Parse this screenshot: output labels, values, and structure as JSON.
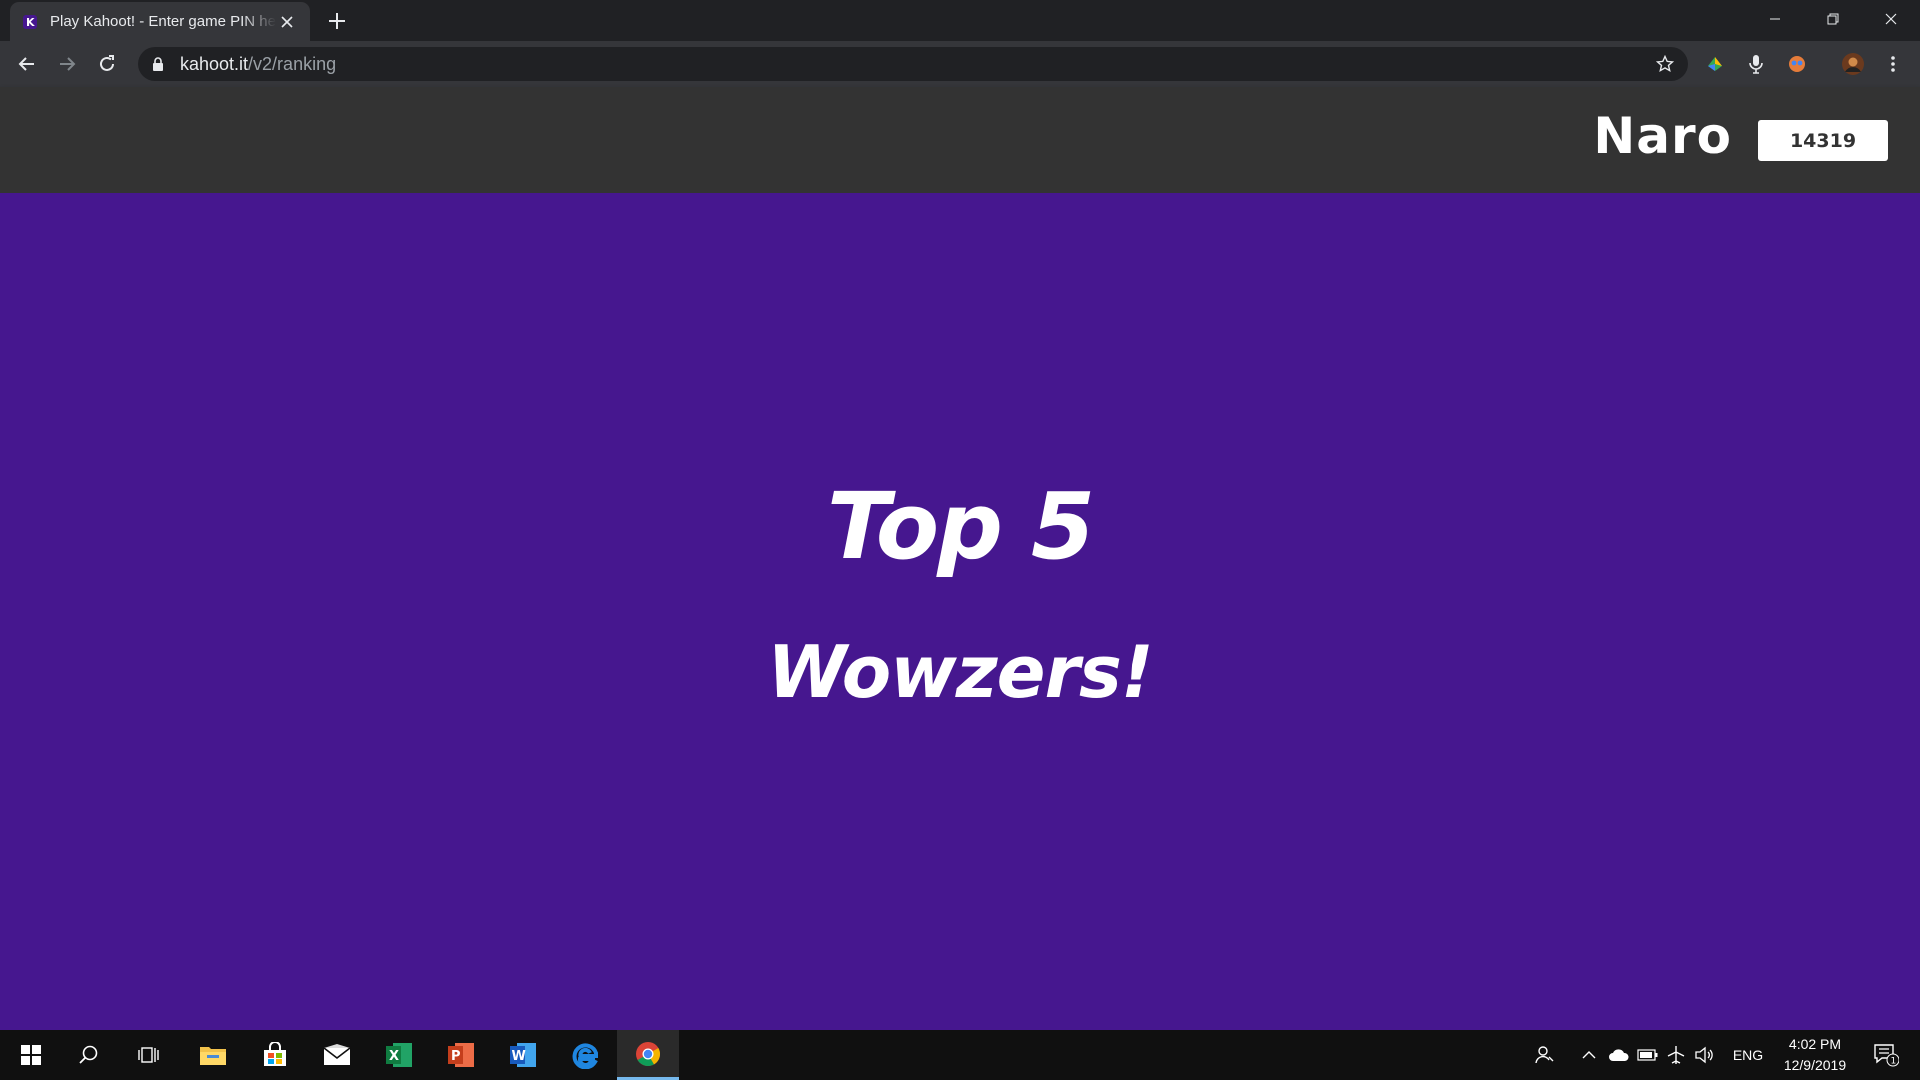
{
  "browser": {
    "tab": {
      "title": "Play Kahoot! - Enter game PIN here"
    },
    "address": {
      "host": "kahoot.it",
      "path": "/v2/ranking"
    }
  },
  "game": {
    "player_name": "Naro",
    "score": "14319",
    "rank_title": "Top 5",
    "praise": "Wowzers!"
  },
  "taskbar": {
    "apps": [
      "start-icon",
      "search-icon",
      "task-view-icon",
      "file-explorer-icon",
      "store-icon",
      "mail-icon",
      "excel-icon",
      "powerpoint-icon",
      "word-icon",
      "edge-icon",
      "chrome-icon"
    ],
    "language": "ENG",
    "time": "4:02 PM",
    "date": "12/9/2019",
    "notification_count": "1"
  },
  "colors": {
    "kahoot_purple": "#46178f",
    "header_gray": "#333333"
  }
}
